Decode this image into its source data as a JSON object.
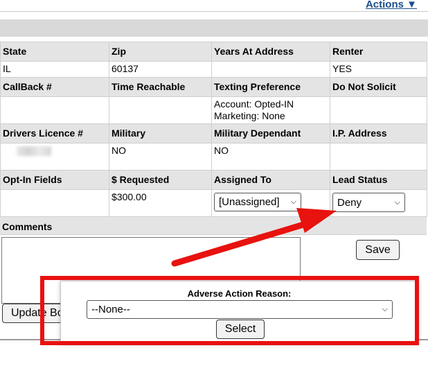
{
  "header": {
    "actions_label": "Actions ▼"
  },
  "grid": {
    "row1_headers": [
      "State",
      "Zip",
      "Years At Address",
      "Renter"
    ],
    "row1_values": [
      "IL",
      "60137",
      "",
      "YES"
    ],
    "row2_headers": [
      "CallBack #",
      "Time Reachable",
      "Texting Preference",
      "Do Not Solicit"
    ],
    "row2_values": [
      "",
      "",
      "Account: Opted-IN",
      ""
    ],
    "row2_values_line2": "Marketing: None",
    "row3_headers": [
      "Drivers Licence #",
      "Military",
      "Military Dependant",
      "I.P. Address"
    ],
    "row3_values": [
      "",
      "NO",
      "NO",
      ""
    ],
    "row4_headers": [
      "Opt-In Fields",
      "$ Requested",
      "Assigned To",
      "Lead Status"
    ],
    "row4_values": [
      "",
      "$300.00"
    ],
    "assigned_to_value": "[Unassigned]",
    "lead_status_value": "Deny"
  },
  "comments": {
    "label": "Comments",
    "value": ""
  },
  "buttons": {
    "save": "Save",
    "update": "Update Bo"
  },
  "modal": {
    "label": "Adverse Action Reason:",
    "selected": "--None--",
    "select_button": "Select"
  },
  "colors": {
    "annotation": "#e8120f",
    "link": "#1a4e8a",
    "header_bg": "#e4e4e4"
  }
}
